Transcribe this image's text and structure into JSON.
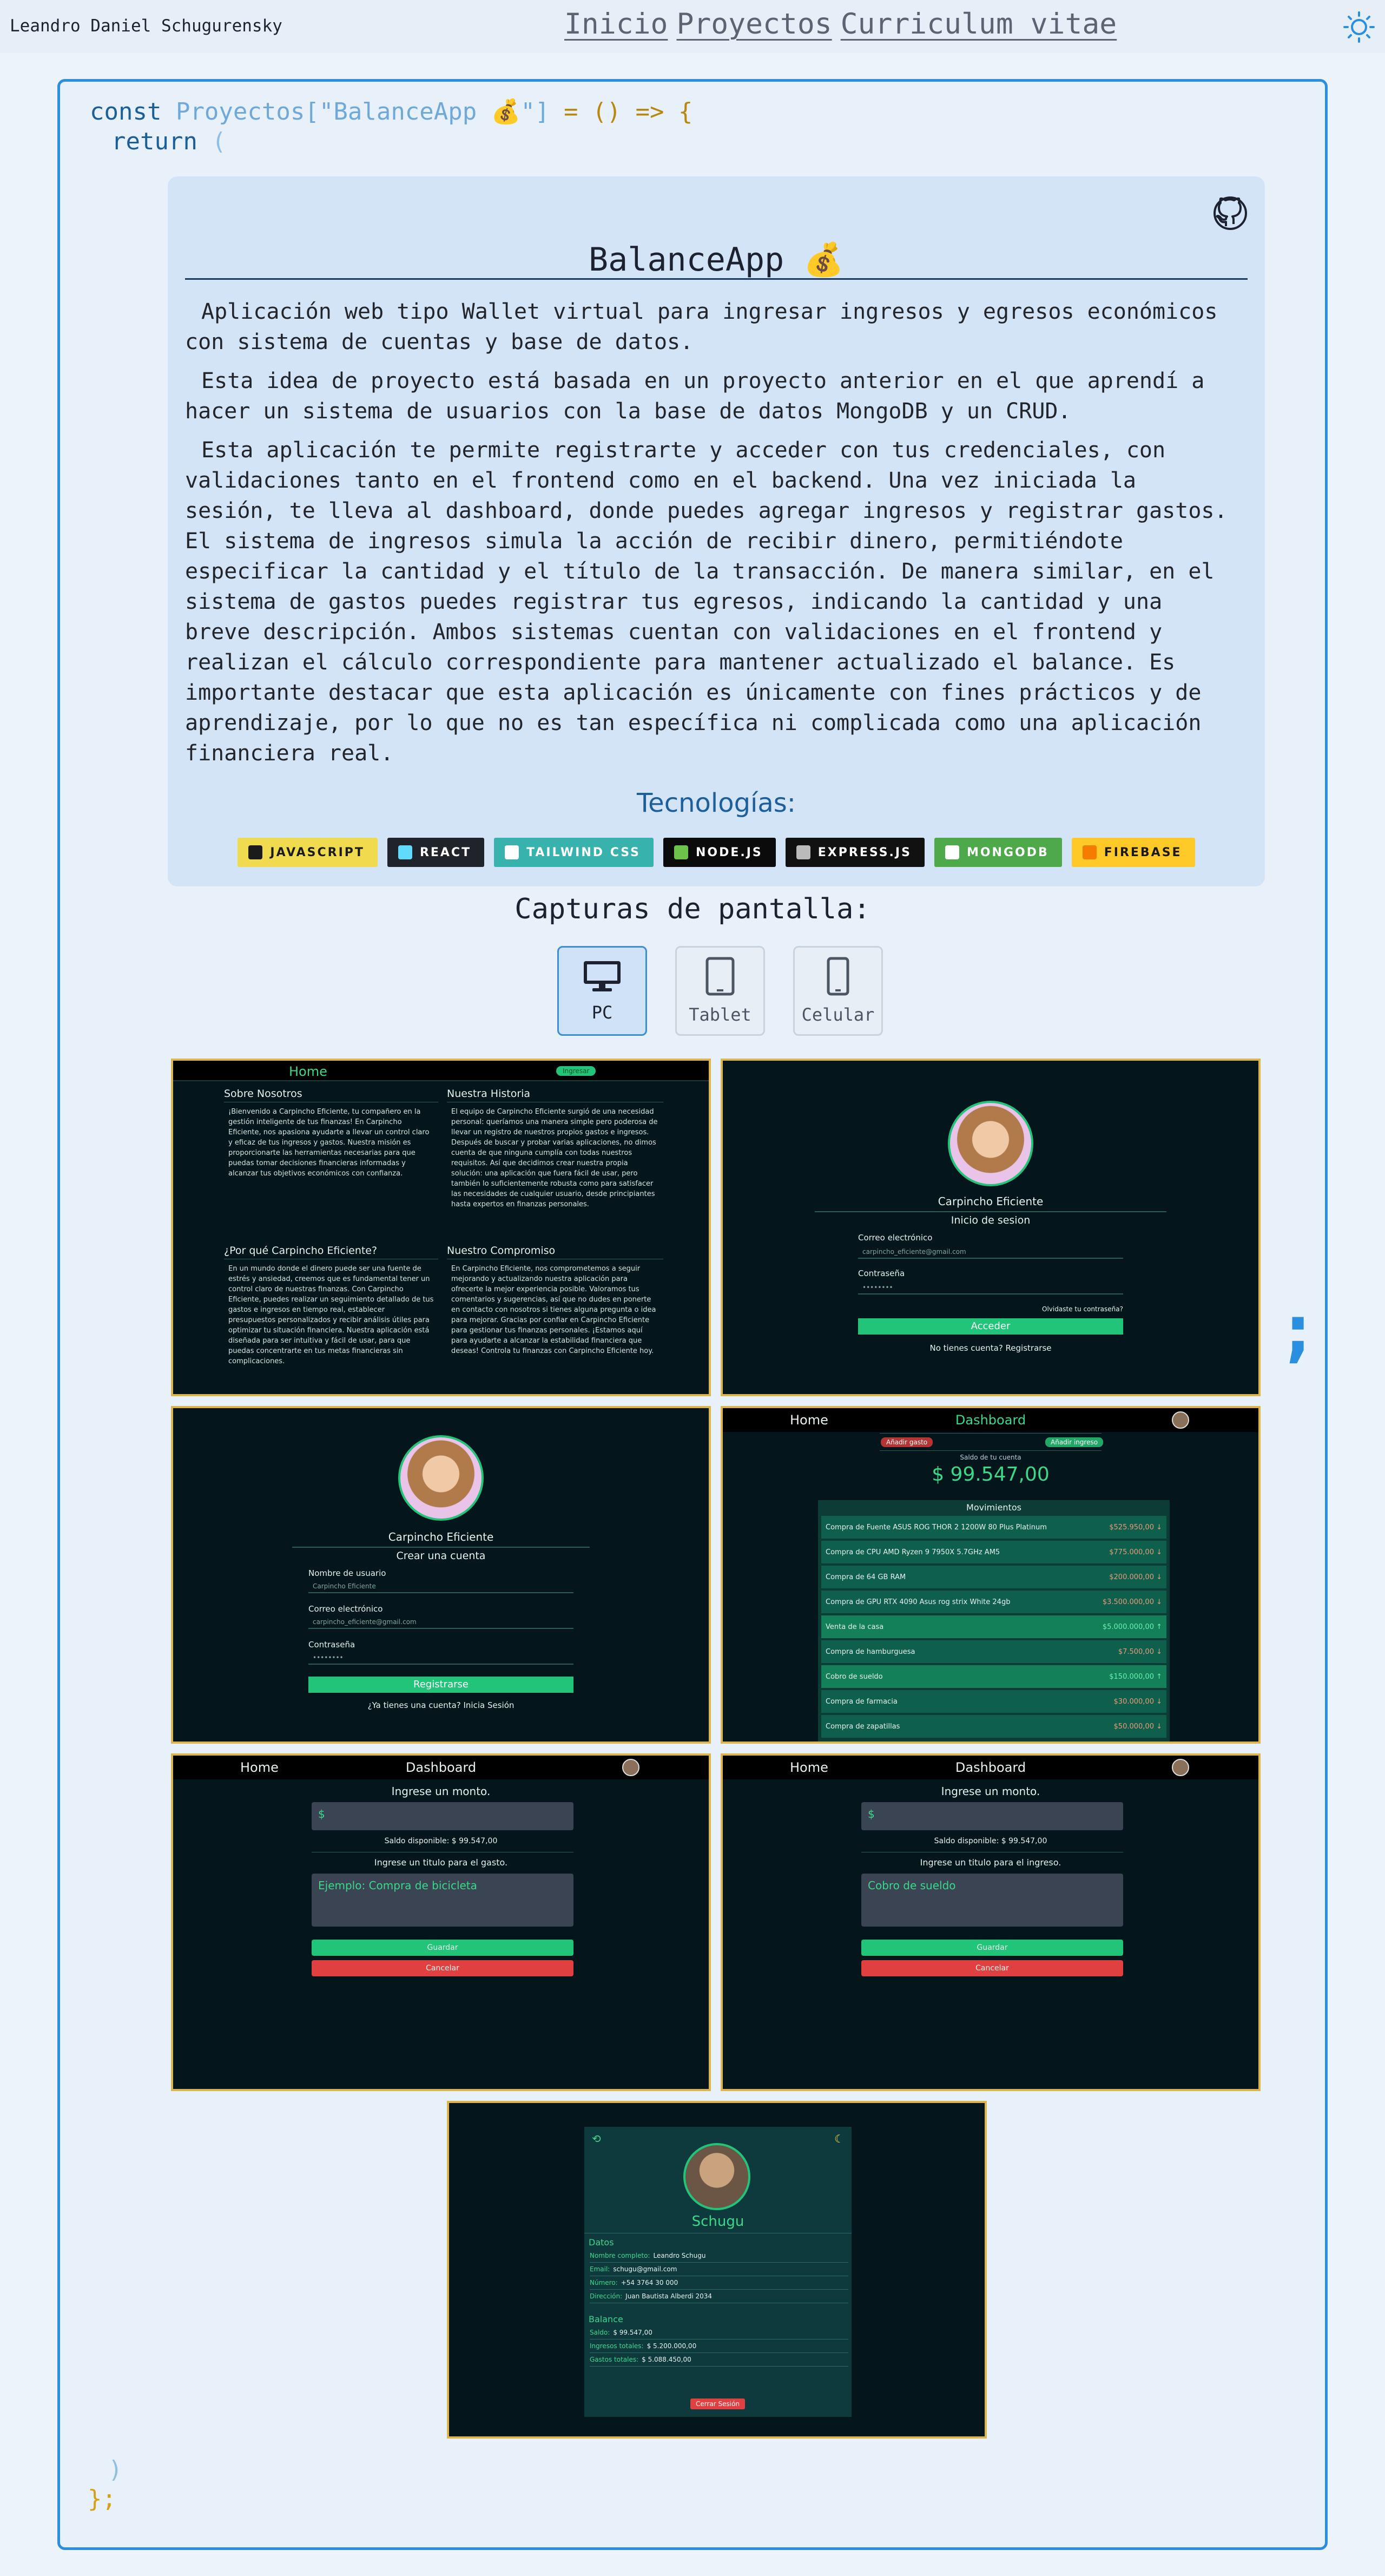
{
  "header": {
    "author": "Leandro Daniel Schugurensky",
    "nav": [
      "Inicio",
      "Proyectos",
      "Curriculum vitae"
    ]
  },
  "code": {
    "const_kw": "const",
    "object": "Proyectos",
    "key": "[\"BalanceApp 💰\"]",
    "arrow": " = () => {",
    "return_kw": "return",
    "open_paren": "(",
    "close_paren": ")",
    "close_brace": "};",
    "semicolon": ";"
  },
  "project": {
    "title": "BalanceApp 💰",
    "paragraphs": [
      "Aplicación web tipo Wallet virtual para ingresar ingresos y egresos económicos con sistema de cuentas y base de datos.",
      "Esta idea de proyecto está basada en un proyecto anterior en el que aprendí a hacer un sistema de usuarios con la base de datos MongoDB y un CRUD.",
      "Esta aplicación te permite registrarte y acceder con tus credenciales, con validaciones tanto en el frontend como en el backend. Una vez iniciada la sesión, te lleva al dashboard, donde puedes agregar ingresos y registrar gastos. El sistema de ingresos simula la acción de recibir dinero, permitiéndote especificar la cantidad y el título de la transacción. De manera similar, en el sistema de gastos puedes registrar tus egresos, indicando la cantidad y una breve descripción. Ambos sistemas cuentan con validaciones en el frontend y realizan el cálculo correspondiente para mantener actualizado el balance. Es importante destacar que esta aplicación es únicamente con fines prácticos y de aprendizaje, por lo que no es tan específica ni complicada como una aplicación financiera real."
    ],
    "tech_title": "Tecnologías:",
    "technologies": [
      {
        "label": "JAVASCRIPT",
        "bg": "#f0db4f",
        "fg": "#1b1b1b",
        "icon": "#1b1b1b"
      },
      {
        "label": "REACT",
        "bg": "#20232a",
        "fg": "#ffffff",
        "icon": "#61dafb"
      },
      {
        "label": "TAILWIND CSS",
        "bg": "#38b2ac",
        "fg": "#ffffff",
        "icon": "#ffffff"
      },
      {
        "label": "NODE.JS",
        "bg": "#0b0b0b",
        "fg": "#ffffff",
        "icon": "#6cc24a"
      },
      {
        "label": "EXPRESS.JS",
        "bg": "#111111",
        "fg": "#ffffff",
        "icon": "#bbbbbb"
      },
      {
        "label": "MONGODB",
        "bg": "#4ea94b",
        "fg": "#ffffff",
        "icon": "#ffffff"
      },
      {
        "label": "FIREBASE",
        "bg": "#ffca28",
        "fg": "#1b1b1b",
        "icon": "#f57c00"
      }
    ]
  },
  "screens": {
    "title": "Capturas de pantalla:",
    "devices": [
      "PC",
      "Tablet",
      "Celular"
    ],
    "active_device": "PC"
  },
  "shot_home": {
    "nav": "Home",
    "btn": "Ingresar",
    "s1_title": "Sobre Nosotros",
    "s1_text": "¡Bienvenido a Carpincho Eficiente, tu compañero en la gestión inteligente de tus finanzas! En Carpincho Eficiente, nos apasiona ayudarte a llevar un control claro y eficaz de tus ingresos y gastos. Nuestra misión es proporcionarte las herramientas necesarias para que puedas tomar decisiones financieras informadas y alcanzar tus objetivos económicos con confianza.",
    "s2_title": "Nuestra Historia",
    "s2_text": "El equipo de Carpincho Eficiente surgió de una necesidad personal: queríamos una manera simple pero poderosa de llevar un registro de nuestros propios gastos e ingresos. Después de buscar y probar varias aplicaciones, no dimos cuenta de que ninguna cumplía con todas nuestros requisitos. Así que decidimos crear nuestra propia solución: una aplicación que fuera fácil de usar, pero también lo suficientemente robusta como para satisfacer las necesidades de cualquier usuario, desde principiantes hasta expertos en finanzas personales.",
    "s3_title": "¿Por qué Carpincho Eficiente?",
    "s3_text": "En un mundo donde el dinero puede ser una fuente de estrés y ansiedad, creemos que es fundamental tener un control claro de nuestras finanzas. Con Carpincho Eficiente, puedes realizar un seguimiento detallado de tus gastos e ingresos en tiempo real, establecer presupuestos personalizados y recibir análisis útiles para optimizar tu situación financiera. Nuestra aplicación está diseñada para ser intuitiva y fácil de usar, para que puedas concentrarte en tus metas financieras sin complicaciones.",
    "s4_title": "Nuestro Compromiso",
    "s4_text": "En Carpincho Eficiente, nos comprometemos a seguir mejorando y actualizando nuestra aplicación para ofrecerte la mejor experiencia posible. Valoramos tus comentarios y sugerencias, así que no dudes en ponerte en contacto con nosotros si tienes alguna pregunta o idea para mejorar. Gracias por confiar en Carpincho Eficiente para gestionar tus finanzas personales. ¡Estamos aquí para ayudarte a alcanzar la estabilidad financiera que deseas! Controla tu finanzas con Carpincho Eficiente hoy."
  },
  "shot_login": {
    "brand": "Carpincho Eficiente",
    "heading": "Inicio de sesion",
    "email_label": "Correo electrónico",
    "email_value": "carpincho_eficiente@gmail.com",
    "pass_label": "Contraseña",
    "pass_value": "••••••••",
    "forgot": "Olvidaste tu contraseña?",
    "submit": "Acceder",
    "footer": "No tienes cuenta?  Registrarse"
  },
  "shot_register": {
    "brand": "Carpincho Eficiente",
    "heading": "Crear una cuenta",
    "user_label": "Nombre de usuario",
    "user_value": "Carpincho Eficiente",
    "email_label": "Correo electrónico",
    "email_value": "carpincho_eficiente@gmail.com",
    "pass_label": "Contraseña",
    "pass_value": "••••••••",
    "submit": "Registrarse",
    "footer": "¿Ya tienes una cuenta?  Inicia Sesión"
  },
  "shot_dashboard": {
    "nav_home": "Home",
    "nav_title": "Dashboard",
    "btn_expense": "Añadir gasto",
    "btn_income": "Añadir ingreso",
    "balance_label": "Saldo de tu cuenta",
    "balance": "$ 99.547,00",
    "movements_title": "Movimientos",
    "movements": [
      {
        "name": "Compra de Fuente ASUS ROG THOR 2 1200W 80 Plus Platinum",
        "amount": "$525.950,00 ↓",
        "type": "out"
      },
      {
        "name": "Compra de CPU AMD Ryzen 9 7950X 5.7GHz AM5",
        "amount": "$775.000,00 ↓",
        "type": "out"
      },
      {
        "name": "Compra de 64 GB RAM",
        "amount": "$200.000,00 ↓",
        "type": "out"
      },
      {
        "name": "Compra de GPU RTX 4090 Asus rog strix White 24gb",
        "amount": "$3.500.000,00 ↓",
        "type": "out"
      },
      {
        "name": "Venta de la casa",
        "amount": "$5.000.000,00 ↑",
        "type": "in"
      },
      {
        "name": "Compra de hamburguesa",
        "amount": "$7.500,00 ↓",
        "type": "out"
      },
      {
        "name": "Cobro de sueldo",
        "amount": "$150.000,00 ↑",
        "type": "in"
      },
      {
        "name": "Compra de farmacia",
        "amount": "$30.000,00 ↓",
        "type": "out"
      },
      {
        "name": "Compra de zapatillas",
        "amount": "$50.000,00 ↓",
        "type": "out"
      }
    ]
  },
  "shot_expense": {
    "nav_home": "Home",
    "nav_title": "Dashboard",
    "amount_label": "Ingrese un monto.",
    "currency": "$",
    "available": "Saldo disponible: $ 99.547,00",
    "title_label": "Ingrese un titulo para el gasto.",
    "placeholder": "Ejemplo: Compra de bicicleta",
    "save": "Guardar",
    "cancel": "Cancelar"
  },
  "shot_income": {
    "nav_home": "Home",
    "nav_title": "Dashboard",
    "amount_label": "Ingrese un monto.",
    "currency": "$",
    "available": "Saldo disponible: $ 99.547,00",
    "title_label": "Ingrese un titulo para el ingreso.",
    "placeholder": "Cobro de sueldo",
    "save": "Guardar",
    "cancel": "Cancelar"
  },
  "shot_profile": {
    "name": "Schugu",
    "datos_title": "Datos",
    "datos": [
      {
        "k": "Nombre completo:",
        "v": "Leandro Schugu"
      },
      {
        "k": "Email:",
        "v": "schugu@gmail.com"
      },
      {
        "k": "Número:",
        "v": "+54 3764 30 000"
      },
      {
        "k": "Dirección:",
        "v": "Juan Bautista Alberdi 2034"
      }
    ],
    "balance_title": "Balance",
    "balance": [
      {
        "k": "Saldo:",
        "v": "$ 99.547,00"
      },
      {
        "k": "Ingresos totales:",
        "v": "$ 5.200.000,00"
      },
      {
        "k": "Gastos totales:",
        "v": "$ 5.088.450,00"
      }
    ],
    "logout": "Cerrar Sesión"
  }
}
